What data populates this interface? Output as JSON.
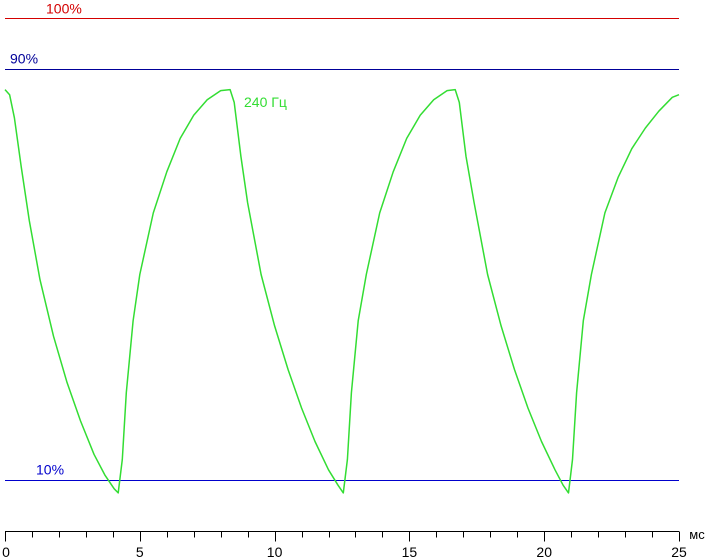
{
  "chart_data": {
    "type": "line",
    "x_unit": "мс",
    "xlim": [
      0,
      25
    ],
    "ylim": [
      0,
      100
    ],
    "grid": false,
    "x_ticks": [
      0,
      5,
      10,
      15,
      20,
      25
    ],
    "x_tick_labels": [
      "0",
      "5",
      "10",
      "15",
      "20",
      "25"
    ],
    "reference_lines": [
      {
        "label": "100%",
        "value": 100,
        "color": "#d40000"
      },
      {
        "label": "90%",
        "value": 90,
        "color": "#000099"
      },
      {
        "label": "10%",
        "value": 10,
        "color": "#0000cc"
      }
    ],
    "series": [
      {
        "name": "240 Гц",
        "color": "#33dd33",
        "points": [
          [
            0.0,
            86.0
          ],
          [
            0.17,
            85.0
          ],
          [
            0.35,
            80.5
          ],
          [
            0.6,
            71.0
          ],
          [
            0.9,
            60.5
          ],
          [
            1.3,
            49.0
          ],
          [
            1.8,
            38.0
          ],
          [
            2.3,
            29.0
          ],
          [
            2.8,
            21.5
          ],
          [
            3.3,
            15.0
          ],
          [
            3.7,
            11.0
          ],
          [
            4.05,
            8.3
          ],
          [
            4.2,
            7.5
          ],
          [
            4.35,
            14.0
          ],
          [
            4.5,
            27.0
          ],
          [
            4.75,
            41.0
          ],
          [
            5.0,
            50.0
          ],
          [
            5.5,
            62.0
          ],
          [
            6.0,
            70.0
          ],
          [
            6.5,
            76.5
          ],
          [
            7.0,
            81.0
          ],
          [
            7.5,
            84.0
          ],
          [
            8.0,
            85.8
          ],
          [
            8.35,
            86.0
          ],
          [
            8.5,
            83.5
          ],
          [
            8.75,
            73.0
          ],
          [
            9.0,
            64.0
          ],
          [
            9.5,
            50.0
          ],
          [
            10.0,
            40.0
          ],
          [
            10.5,
            31.5
          ],
          [
            11.0,
            24.0
          ],
          [
            11.5,
            17.5
          ],
          [
            12.0,
            12.0
          ],
          [
            12.35,
            9.0
          ],
          [
            12.55,
            7.5
          ],
          [
            12.7,
            14.0
          ],
          [
            12.85,
            27.0
          ],
          [
            13.1,
            41.0
          ],
          [
            13.4,
            50.0
          ],
          [
            13.9,
            62.0
          ],
          [
            14.4,
            70.0
          ],
          [
            14.9,
            76.5
          ],
          [
            15.4,
            81.0
          ],
          [
            15.9,
            84.0
          ],
          [
            16.4,
            85.8
          ],
          [
            16.7,
            86.0
          ],
          [
            16.85,
            83.5
          ],
          [
            17.1,
            73.0
          ],
          [
            17.4,
            64.0
          ],
          [
            17.9,
            50.0
          ],
          [
            18.4,
            40.0
          ],
          [
            18.9,
            31.5
          ],
          [
            19.4,
            24.0
          ],
          [
            19.9,
            17.5
          ],
          [
            20.4,
            12.0
          ],
          [
            20.7,
            9.0
          ],
          [
            20.9,
            7.5
          ],
          [
            21.05,
            14.0
          ],
          [
            21.2,
            27.0
          ],
          [
            21.45,
            41.0
          ],
          [
            21.75,
            50.0
          ],
          [
            22.25,
            62.0
          ],
          [
            22.75,
            69.0
          ],
          [
            23.25,
            74.5
          ],
          [
            23.75,
            78.5
          ],
          [
            24.25,
            81.8
          ],
          [
            24.75,
            84.5
          ],
          [
            25.0,
            85.0
          ]
        ]
      }
    ]
  }
}
